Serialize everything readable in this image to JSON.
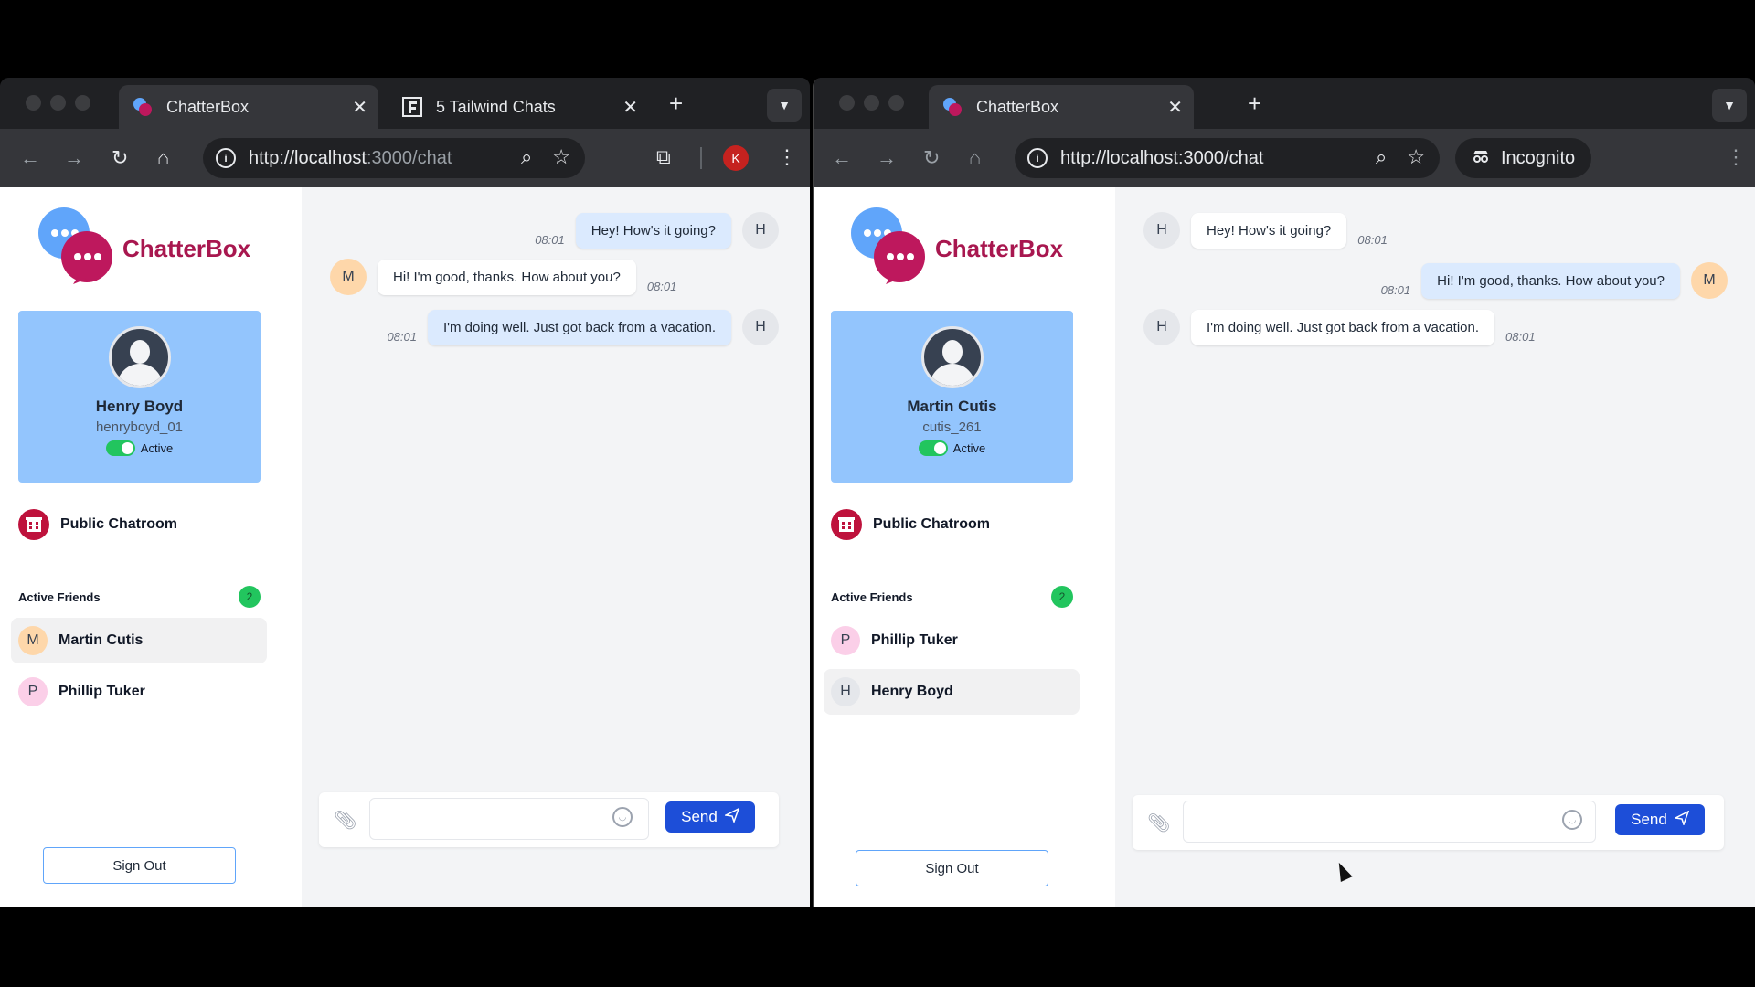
{
  "app": {
    "brand": "ChatterBox"
  },
  "left": {
    "tabs": [
      {
        "label": "ChatterBox"
      },
      {
        "label": "5 Tailwind Chats"
      }
    ],
    "url_host": "http://localhost",
    "url_path": ":3000/chat",
    "profile_initial": "K",
    "user": {
      "name": "Henry Boyd",
      "handle": "henryboyd_01",
      "status": "Active"
    },
    "public_room": "Public Chatroom",
    "friends_title": "Active Friends",
    "friends_count": "2",
    "friends": [
      {
        "initial": "M",
        "name": "Martin Cutis"
      },
      {
        "initial": "P",
        "name": "Phillip Tuker"
      }
    ],
    "messages": [
      {
        "text": "Hey! How's it going?",
        "time": "08:01",
        "avatar": "H"
      },
      {
        "text": "Hi! I'm good, thanks. How about you?",
        "time": "08:01",
        "avatar": "M"
      },
      {
        "text": "I'm doing well. Just got back from a vacation.",
        "time": "08:01",
        "avatar": "H"
      }
    ],
    "signout": "Sign Out",
    "send": "Send",
    "input_value": ""
  },
  "right": {
    "tabs": [
      {
        "label": "ChatterBox"
      }
    ],
    "url": "http://localhost:3000/chat",
    "incognito": "Incognito",
    "user": {
      "name": "Martin Cutis",
      "handle": "cutis_261",
      "status": "Active"
    },
    "public_room": "Public Chatroom",
    "friends_title": "Active Friends",
    "friends_count": "2",
    "friends": [
      {
        "initial": "P",
        "name": "Phillip Tuker"
      },
      {
        "initial": "H",
        "name": "Henry Boyd"
      }
    ],
    "messages": [
      {
        "text": "Hey! How's it going?",
        "time": "08:01",
        "avatar": "H"
      },
      {
        "text": "Hi! I'm good, thanks. How about you?",
        "time": "08:01",
        "avatar": "M"
      },
      {
        "text": "I'm doing well. Just got back from a vacation.",
        "time": "08:01",
        "avatar": "H"
      }
    ],
    "signout": "Sign Out",
    "send": "Send",
    "input_value": ""
  },
  "icons": {
    "back": "arrow-left-icon",
    "forward": "arrow-right-icon",
    "reload": "reload-icon",
    "home": "home-icon",
    "zoom": "zoom-icon",
    "star": "star-icon",
    "clip": "paperclip-icon",
    "emoji": "smiley-icon",
    "send": "paper-plane-icon"
  },
  "colors": {
    "brand": "#a8174f",
    "card": "#93c5fd",
    "send": "#1d4ed8",
    "active": "#22c55e"
  }
}
